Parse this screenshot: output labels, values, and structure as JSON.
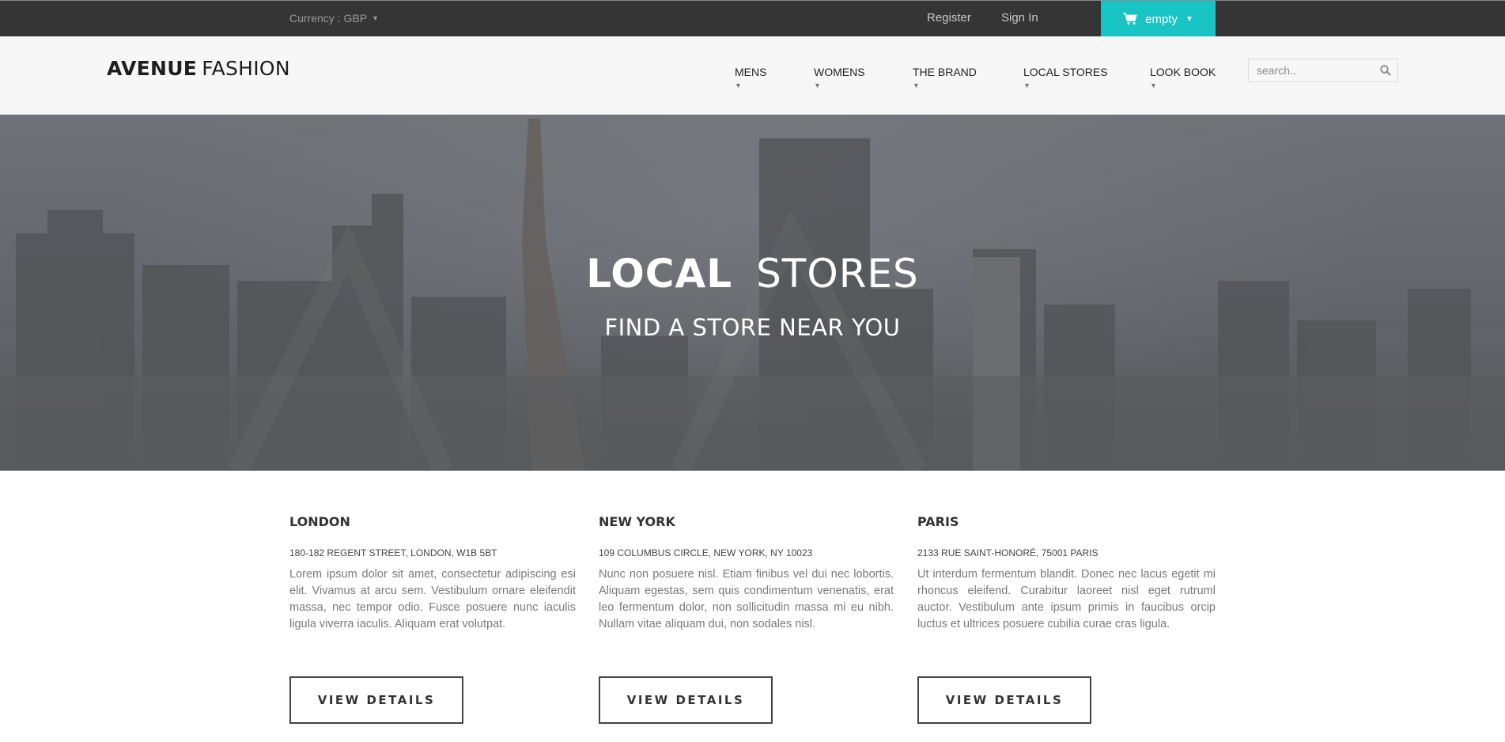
{
  "topbar": {
    "currency": "Currency : GBP",
    "register": "Register",
    "signin": "Sign In",
    "cart_label": "empty",
    "cart_color": "#18c4c4"
  },
  "header": {
    "logo_bold": "AVENUE",
    "logo_light": "FASHION",
    "nav": [
      "MENS",
      "WOMENS",
      "THE BRAND",
      "LOCAL STORES",
      "LOOK BOOK"
    ],
    "search_placeholder": "search.."
  },
  "hero": {
    "title_bold": "LOCAL",
    "title_light": "STORES",
    "subtitle": "FIND A STORE NEAR YOU"
  },
  "stores": [
    {
      "city": "LONDON",
      "address": "180-182 REGENT STREET, LONDON, W1B 5BT",
      "text": "Lorem ipsum dolor sit amet, consectetur adipiscing esi elit. Vivamus at arcu sem. Vestibulum ornare eleifendit massa, nec tempor odio. Fusce posuere nunc iaculis ligula viverra iaculis. Aliquam erat volutpat.",
      "button": "VIEW DETAILS"
    },
    {
      "city": "NEW YORK",
      "address": "109 COLUMBUS CIRCLE, NEW YORK, NY 10023",
      "text": "Nunc non posuere nisl. Etiam finibus vel dui nec lobortis. Aliquam egestas, sem quis condimentum venenatis, erat leo fermentum dolor, non sollicitudin massa mi eu nibh. Nullam vitae aliquam dui, non sodales nisl.",
      "button": "VIEW DETAILS"
    },
    {
      "city": "PARIS",
      "address": "2133 RUE SAINT-HONORÉ, 75001 PARIS",
      "text": "Ut interdum fermentum blandit. Donec nec lacus egetit mi rhoncus eleifend. Curabitur laoreet nisl eget rutruml auctor. Vestibulum ante ipsum primis in faucibus orcip luctus et ultrices posuere cubilia curae cras ligula.",
      "button": "VIEW DETAILS"
    }
  ]
}
